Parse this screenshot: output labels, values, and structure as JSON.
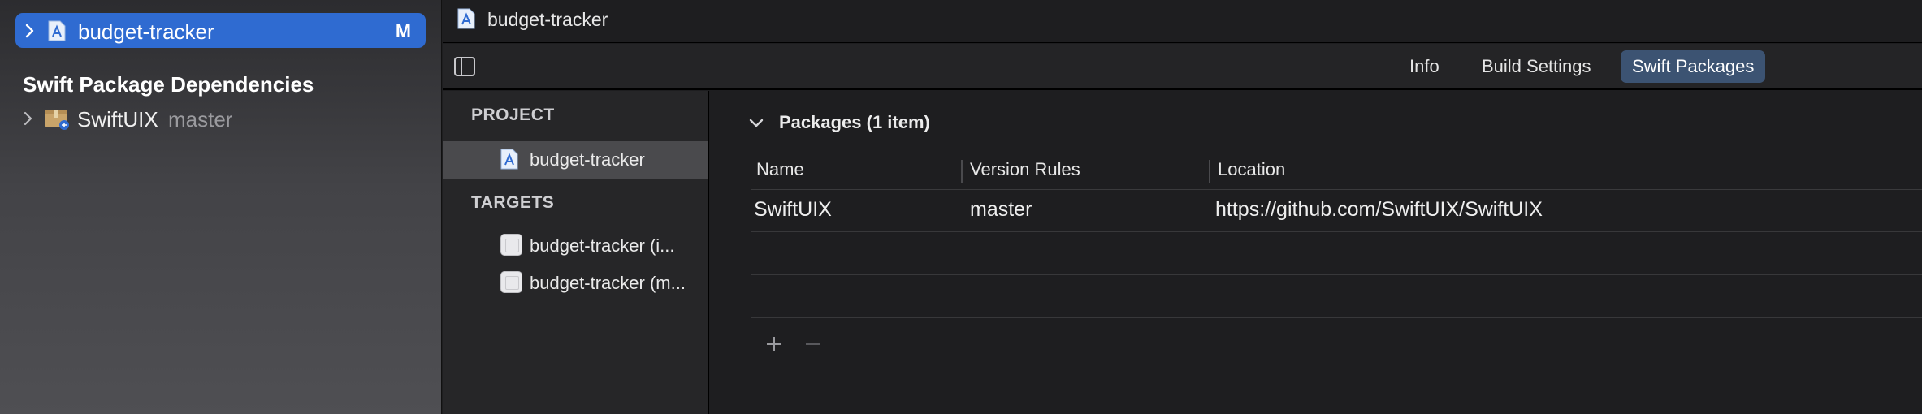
{
  "navigator": {
    "selected_item": {
      "label": "budget-tracker",
      "badge": "M"
    },
    "section_title": "Swift Package Dependencies",
    "packages": [
      {
        "name": "SwiftUIX",
        "branch": "master"
      }
    ]
  },
  "jumpbar": {
    "label": "budget-tracker"
  },
  "tabs": [
    {
      "label": "Info",
      "selected": false
    },
    {
      "label": "Build Settings",
      "selected": false
    },
    {
      "label": "Swift Packages",
      "selected": true
    }
  ],
  "project_list": {
    "project_header": "PROJECT",
    "project_item": "budget-tracker",
    "targets_header": "TARGETS",
    "targets": [
      {
        "label": "budget-tracker (i..."
      },
      {
        "label": "budget-tracker (m..."
      }
    ]
  },
  "packages_pane": {
    "section_title": "Packages (1 item)",
    "columns": [
      "Name",
      "Version Rules",
      "Location"
    ],
    "rows": [
      {
        "name": "SwiftUIX",
        "version_rule": "master",
        "location": "https://github.com/SwiftUIX/SwiftUIX"
      }
    ]
  },
  "colors": {
    "selection_blue": "#2f6bd1",
    "tab_selected": "#3c5372",
    "background": "#1e1e20"
  },
  "icons": {
    "disclosure": "chevron-right-icon",
    "project": "xcode-project-icon",
    "package": "swift-package-icon",
    "sidebar_toggle": "sidebar-toggle-icon",
    "add": "plus-icon",
    "remove": "minus-icon"
  }
}
